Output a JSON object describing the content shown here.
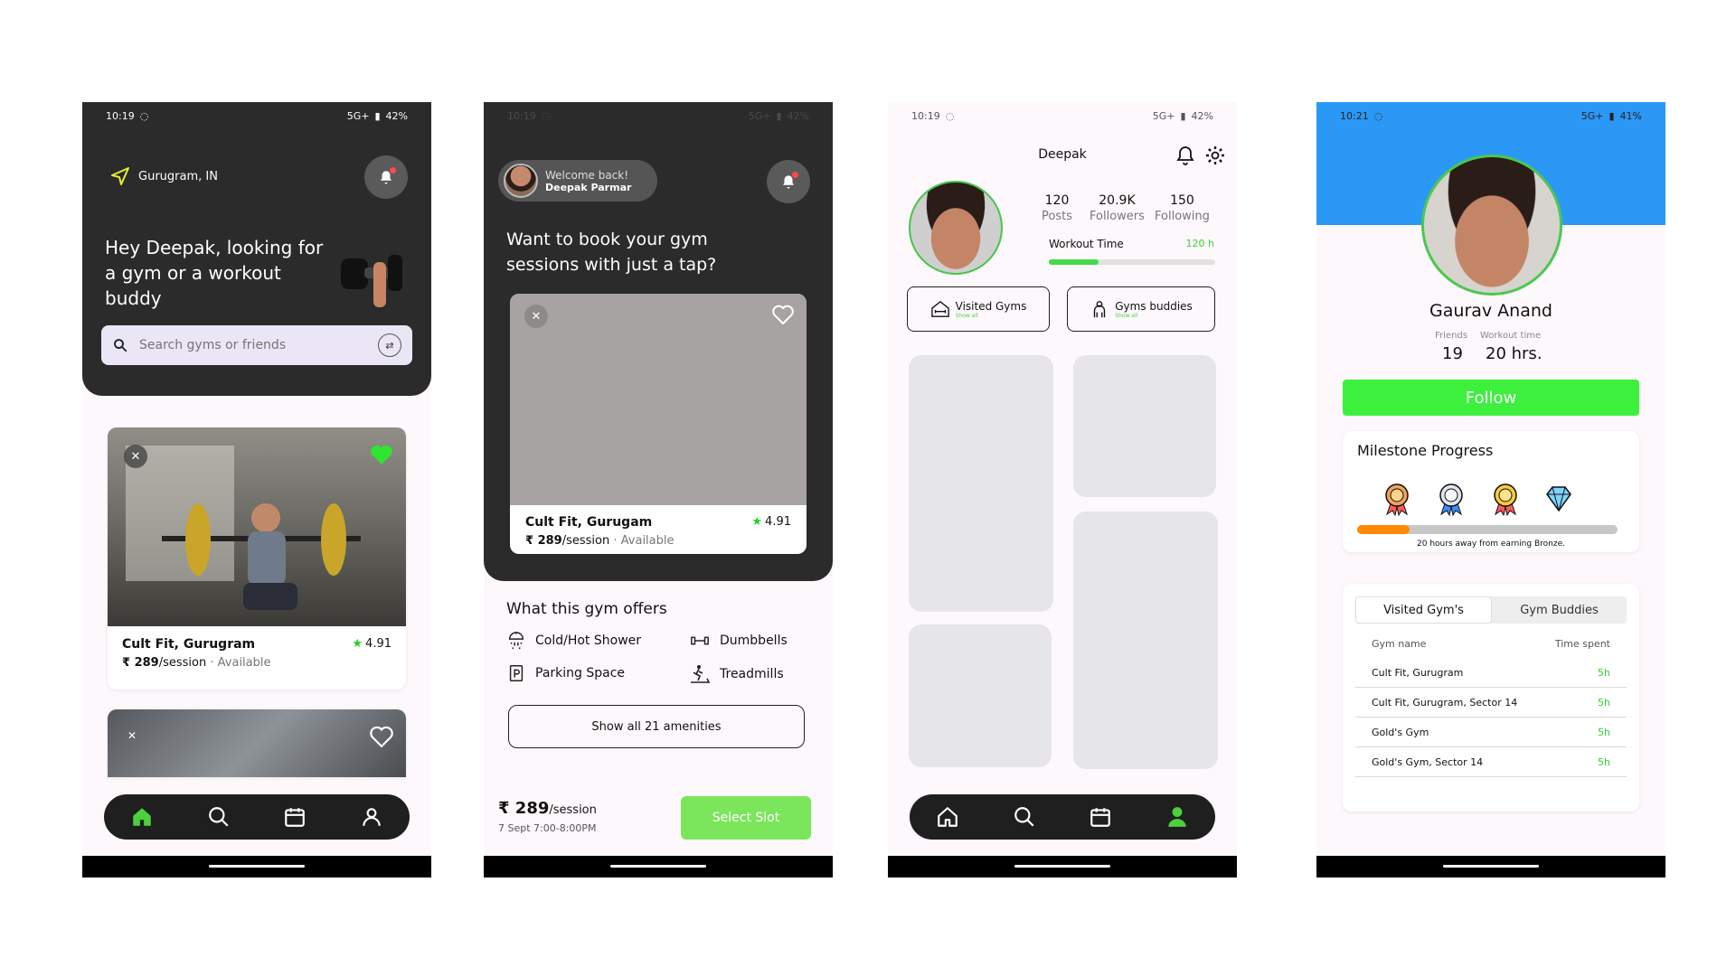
{
  "status_bar": {
    "time_a": "10:19",
    "time_b": "10:21",
    "net": "5G+",
    "battery_a": "42%",
    "battery_b": "41%"
  },
  "screen1": {
    "location": "Gurugram, IN",
    "headline": "Hey Deepak, looking for a gym or a workout buddy",
    "search_placeholder": "Search gyms or friends",
    "card1": {
      "name": "Cult Fit, Gurugram",
      "rating": "4.91",
      "price": "₹ 289",
      "per": "/session",
      "availability": "Available"
    }
  },
  "screen2": {
    "welcome": "Welcome back!",
    "user": "Deepak Parmar",
    "headline": "Want to book your gym sessions with just a tap?",
    "card": {
      "name": "Cult Fit, Gurugam",
      "rating": "4.91",
      "price": "₹ 289",
      "per": "/session",
      "availability": "Available"
    },
    "offers_title": "What this gym offers",
    "amenities": [
      "Cold/Hot Shower",
      "Dumbbells",
      "Parking Space",
      "Treadmills"
    ],
    "show_all": "Show all 21 amenities",
    "footer_price": "₹ 289",
    "footer_per": "/session",
    "footer_date": "7 Sept 7:00-8:00PM",
    "select_slot": "Select Slot"
  },
  "screen3": {
    "username": "Deepak",
    "posts_count": "120",
    "posts_label": "Posts",
    "followers_count": "20.9K",
    "followers_label": "Followers",
    "following_count": "150",
    "following_label": "Following",
    "workout_label": "Workout Time",
    "workout_value": "120 h",
    "workout_progress": 0.3,
    "visited_gyms": "Visited Gyms",
    "gym_buddies": "Gyms buddies",
    "show_all": "Show all"
  },
  "screen4": {
    "name": "Gaurav Anand",
    "friends_label": "Friends",
    "friends_value": "19",
    "workout_label": "Workout time",
    "workout_value": "20 hrs.",
    "follow": "Follow",
    "milestone_title": "Milestone Progress",
    "milestone_note": "20 hours away from earning Bronze.",
    "milestone_progress": 0.2,
    "tab_visited": "Visited Gym's",
    "tab_buddies": "Gym Buddies",
    "col_name": "Gym name",
    "col_time": "Time spent",
    "rows": [
      {
        "name": "Cult Fit, Gurugram",
        "time": "5h"
      },
      {
        "name": "Cult Fit, Gurugram, Sector 14",
        "time": "5h"
      },
      {
        "name": "Gold's Gym",
        "time": "5h"
      },
      {
        "name": "Gold's Gym, Sector 14",
        "time": "5h"
      }
    ]
  },
  "colors": {
    "accent_green": "#3ef03e",
    "dark": "#2b2b2b",
    "blue": "#2b98f5",
    "orange": "#ff8a00"
  }
}
